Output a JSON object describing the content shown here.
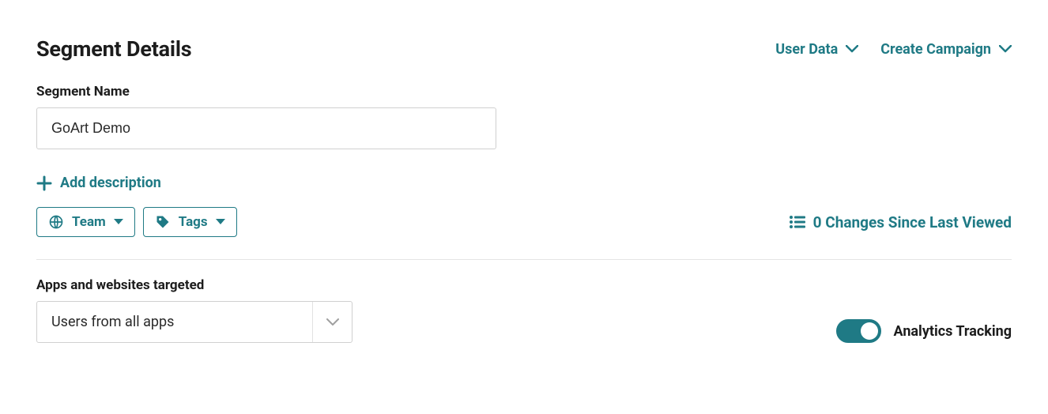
{
  "header": {
    "title": "Segment Details",
    "actions": {
      "user_data": "User Data",
      "create_campaign": "Create Campaign"
    }
  },
  "form": {
    "segment_name_label": "Segment Name",
    "segment_name_value": "GoArt Demo",
    "add_description_label": "Add description",
    "team_chip_label": "Team",
    "tags_chip_label": "Tags"
  },
  "changes": {
    "text": "0 Changes Since Last Viewed"
  },
  "targets": {
    "label": "Apps and websites targeted",
    "value": "Users from all apps"
  },
  "analytics": {
    "label": "Analytics Tracking",
    "on": true
  }
}
